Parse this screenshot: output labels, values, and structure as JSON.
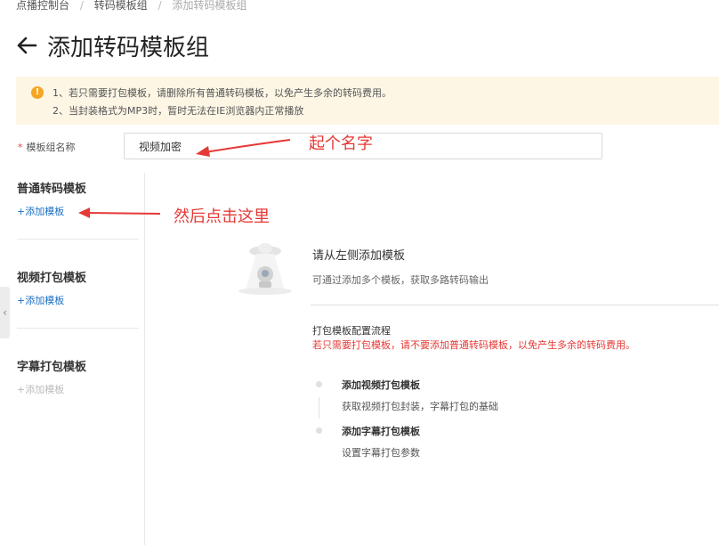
{
  "breadcrumb": {
    "items": [
      "点播控制台",
      "转码模板组"
    ],
    "current": "添加转码模板组",
    "separator": "/"
  },
  "page": {
    "title": "添加转码模板组",
    "back_icon": "arrow-left-icon"
  },
  "notice": {
    "icon": "warning-icon",
    "lines": [
      "1、若只需要打包模板，请删除所有普通转码模板，以免产生多余的转码费用。",
      "2、当封装格式为MP3时，暂时无法在IE浏览器内正常播放"
    ],
    "bg_color": "#fdf6e5",
    "icon_color": "#f5a623"
  },
  "form": {
    "name_label": "模板组名称",
    "required_mark": "*",
    "name_value": "视频加密"
  },
  "sidebar": {
    "sections": [
      {
        "title": "普通转码模板",
        "add_label": "+添加模板",
        "enabled": true
      },
      {
        "title": "视频打包模板",
        "add_label": "+添加模板",
        "enabled": true
      },
      {
        "title": "字幕打包模板",
        "add_label": "+添加模板",
        "enabled": false
      }
    ],
    "collapse_icon": "chevron-left-icon"
  },
  "annotations": {
    "name_hint": "起个名字",
    "click_hint": "然后点击这里",
    "color": "#e53935"
  },
  "empty_state": {
    "illustration": "ufo-robot-illustration",
    "title": "请从左侧添加模板",
    "subtitle": "可通过添加多个模板，获取多路转码输出"
  },
  "flow": {
    "title": "打包模板配置流程",
    "warning": "若只需要打包模板，请不要添加普通转码模板，以免产生多余的转码费用。",
    "steps": [
      {
        "title": "添加视频打包模板",
        "desc": "获取视频打包封装，字幕打包的基础"
      },
      {
        "title": "添加字幕打包模板",
        "desc": "设置字幕打包参数"
      }
    ]
  },
  "colors": {
    "link": "#1a6fc4",
    "warning_text": "#e53935"
  }
}
